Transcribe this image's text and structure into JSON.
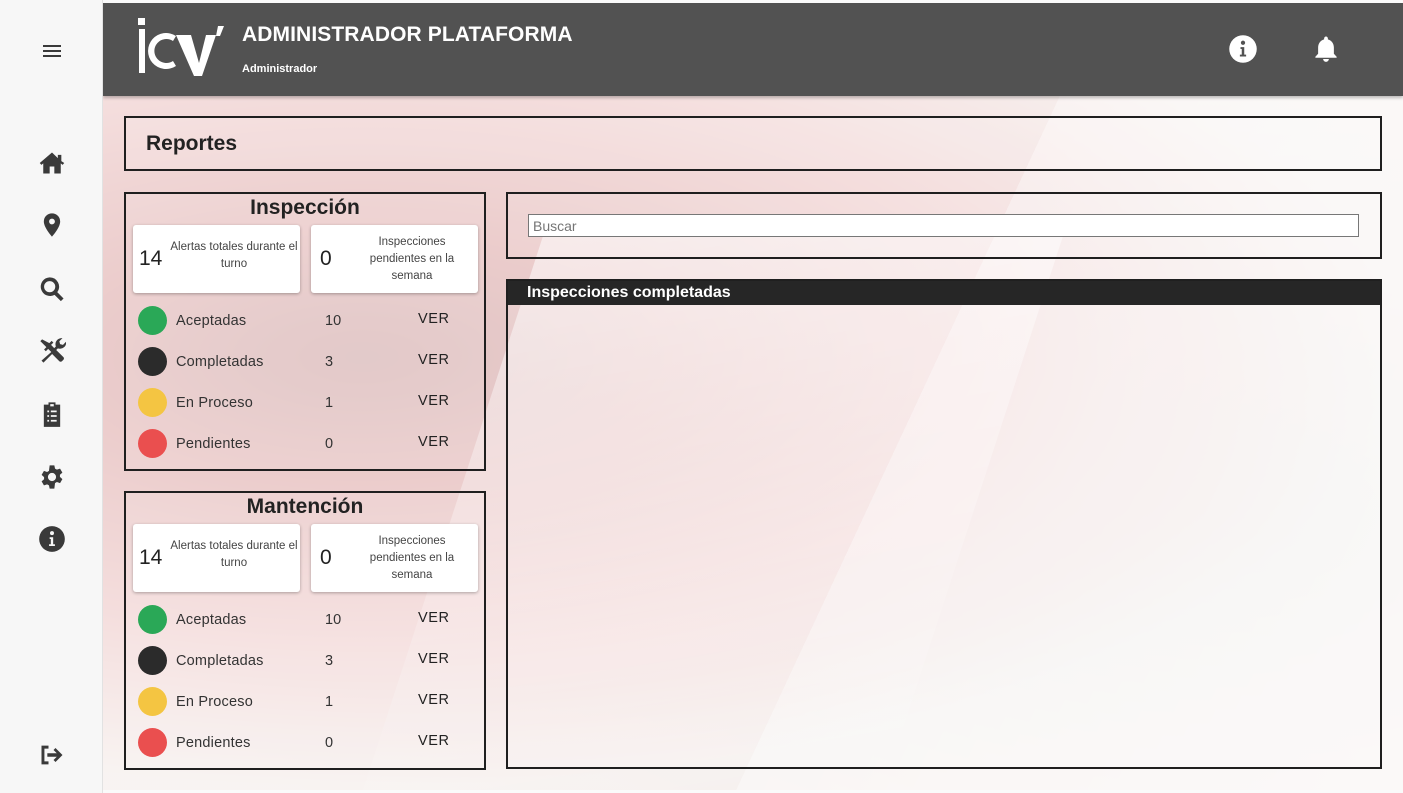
{
  "header": {
    "title": "ADMINISTRADOR PLATAFORMA",
    "subtitle": "Administrador",
    "logo_text": "ICV"
  },
  "sidebar": {
    "items": [
      {
        "name": "menu-icon"
      },
      {
        "name": "home-icon"
      },
      {
        "name": "location-icon"
      },
      {
        "name": "search-icon"
      },
      {
        "name": "tools-icon"
      },
      {
        "name": "clipboard-icon"
      },
      {
        "name": "gear-icon"
      },
      {
        "name": "info-icon"
      },
      {
        "name": "logout-icon"
      }
    ]
  },
  "page": {
    "title": "Reportes"
  },
  "panels": [
    {
      "title": "Inspección",
      "cards": [
        {
          "value": "14",
          "text": "Alertas totales durante el turno"
        },
        {
          "value": "0",
          "text": "Inspecciones pendientes en la semana"
        }
      ],
      "rows": [
        {
          "label": "Aceptadas",
          "count": "10",
          "action": "VER",
          "color": "#2aa857"
        },
        {
          "label": "Completadas",
          "count": "3",
          "action": "VER",
          "color": "#2b2b2b"
        },
        {
          "label": "En Proceso",
          "count": "1",
          "action": "VER",
          "color": "#f4c542"
        },
        {
          "label": "Pendientes",
          "count": "0",
          "action": "VER",
          "color": "#ea4f4f"
        }
      ]
    },
    {
      "title": "Mantención",
      "cards": [
        {
          "value": "14",
          "text": "Alertas totales durante el turno"
        },
        {
          "value": "0",
          "text": "Inspecciones pendientes en la semana"
        }
      ],
      "rows": [
        {
          "label": "Aceptadas",
          "count": "10",
          "action": "VER",
          "color": "#2aa857"
        },
        {
          "label": "Completadas",
          "count": "3",
          "action": "VER",
          "color": "#2b2b2b"
        },
        {
          "label": "En Proceso",
          "count": "1",
          "action": "VER",
          "color": "#f4c542"
        },
        {
          "label": "Pendientes",
          "count": "0",
          "action": "VER",
          "color": "#ea4f4f"
        }
      ]
    }
  ],
  "search": {
    "placeholder": "Buscar"
  },
  "table": {
    "title": "Inspecciones completadas"
  }
}
